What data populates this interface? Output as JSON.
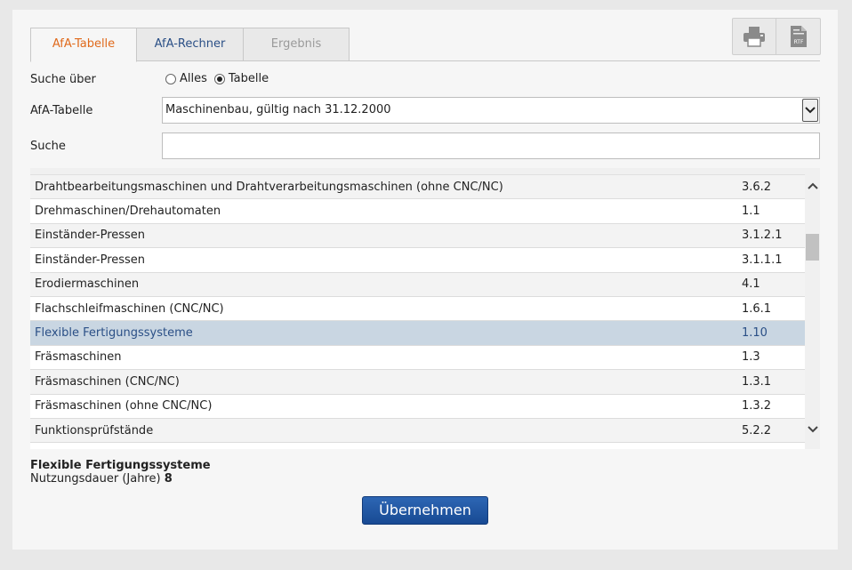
{
  "tabs": [
    {
      "label": "AfA-Tabelle",
      "active": true
    },
    {
      "label": "AfA-Rechner",
      "active": false
    },
    {
      "label": "Ergebnis",
      "active": false
    }
  ],
  "toolbar": {
    "print_icon": "printer-icon",
    "rtf_icon": "rtf-document-icon",
    "rtf_label": "RTF"
  },
  "form": {
    "search_over_label": "Suche über",
    "radio_all": "Alles",
    "radio_table": "Tabelle",
    "radio_selected": "Tabelle",
    "afa_table_label": "AfA-Tabelle",
    "afa_table_value": "Maschinenbau, gültig nach 31.12.2000",
    "search_label": "Suche",
    "search_value": "",
    "search_placeholder": ""
  },
  "list": {
    "rows": [
      {
        "name": "Drahtbearbeitungsmaschinen und Drahtverarbeitungsmaschinen (ohne CNC/NC)",
        "code": "3.6.2"
      },
      {
        "name": "Drehmaschinen/Drehautomaten",
        "code": "1.1"
      },
      {
        "name": "Einständer-Pressen",
        "code": "3.1.2.1"
      },
      {
        "name": "Einständer-Pressen",
        "code": "3.1.1.1"
      },
      {
        "name": "Erodiermaschinen",
        "code": "4.1"
      },
      {
        "name": "Flachschleifmaschinen (CNC/NC)",
        "code": "1.6.1"
      },
      {
        "name": "Flexible Fertigungssysteme",
        "code": "1.10",
        "selected": true
      },
      {
        "name": "Fräsmaschinen",
        "code": "1.3"
      },
      {
        "name": "Fräsmaschinen (CNC/NC)",
        "code": "1.3.1"
      },
      {
        "name": "Fräsmaschinen (ohne CNC/NC)",
        "code": "1.3.2"
      },
      {
        "name": "Funktionsprüfstände",
        "code": "5.2.2"
      }
    ]
  },
  "result": {
    "title": "Flexible Fertigungssysteme",
    "label": "Nutzungsdauer (Jahre)",
    "value": "8"
  },
  "apply_button": "Übernehmen",
  "colors": {
    "active_tab": "#e06a1c",
    "link_tab": "#2a4f86",
    "selected_row": "#c9d6e2",
    "button": "#1f56a2"
  }
}
